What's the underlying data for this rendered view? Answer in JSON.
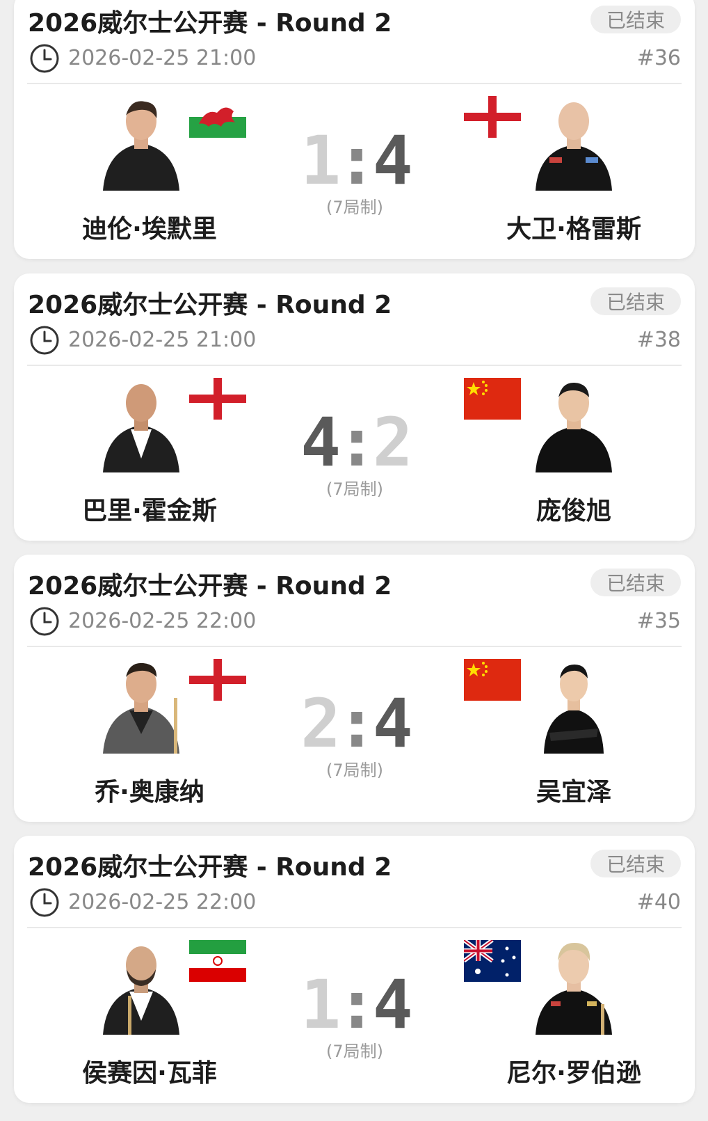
{
  "matches": [
    {
      "title": "2026威尔士公开赛 - Round 2",
      "status": "已结束",
      "datetime": "2026-02-25 21:00",
      "match_no": "#36",
      "score_left": "1",
      "score_sep": ":",
      "score_right": "4",
      "format": "(7局制)",
      "left": {
        "name": "迪伦·埃默里",
        "flag": "wales-flag-icon"
      },
      "right": {
        "name": "大卫·格雷斯",
        "flag": "england-flag-icon"
      }
    },
    {
      "title": "2026威尔士公开赛 - Round 2",
      "status": "已结束",
      "datetime": "2026-02-25 21:00",
      "match_no": "#38",
      "score_left": "4",
      "score_sep": ":",
      "score_right": "2",
      "format": "(7局制)",
      "left": {
        "name": "巴里·霍金斯",
        "flag": "england-flag-icon"
      },
      "right": {
        "name": "庞俊旭",
        "flag": "china-flag-icon"
      }
    },
    {
      "title": "2026威尔士公开赛 - Round 2",
      "status": "已结束",
      "datetime": "2026-02-25 22:00",
      "match_no": "#35",
      "score_left": "2",
      "score_sep": ":",
      "score_right": "4",
      "format": "(7局制)",
      "left": {
        "name": "乔·奥康纳",
        "flag": "england-flag-icon"
      },
      "right": {
        "name": "吴宜泽",
        "flag": "china-flag-icon"
      }
    },
    {
      "title": "2026威尔士公开赛 - Round 2",
      "status": "已结束",
      "datetime": "2026-02-25 22:00",
      "match_no": "#40",
      "score_left": "1",
      "score_sep": ":",
      "score_right": "4",
      "format": "(7局制)",
      "left": {
        "name": "侯赛因·瓦菲",
        "flag": "iran-flag-icon"
      },
      "right": {
        "name": "尼尔·罗伯逊",
        "flag": "australia-flag-icon"
      }
    }
  ],
  "colors": {
    "card_bg": "#ffffff",
    "page_bg": "#efefef",
    "status_bg": "#eeeeee",
    "winning_score": "#5a5a5a",
    "losing_score": "#cfcfcf"
  }
}
